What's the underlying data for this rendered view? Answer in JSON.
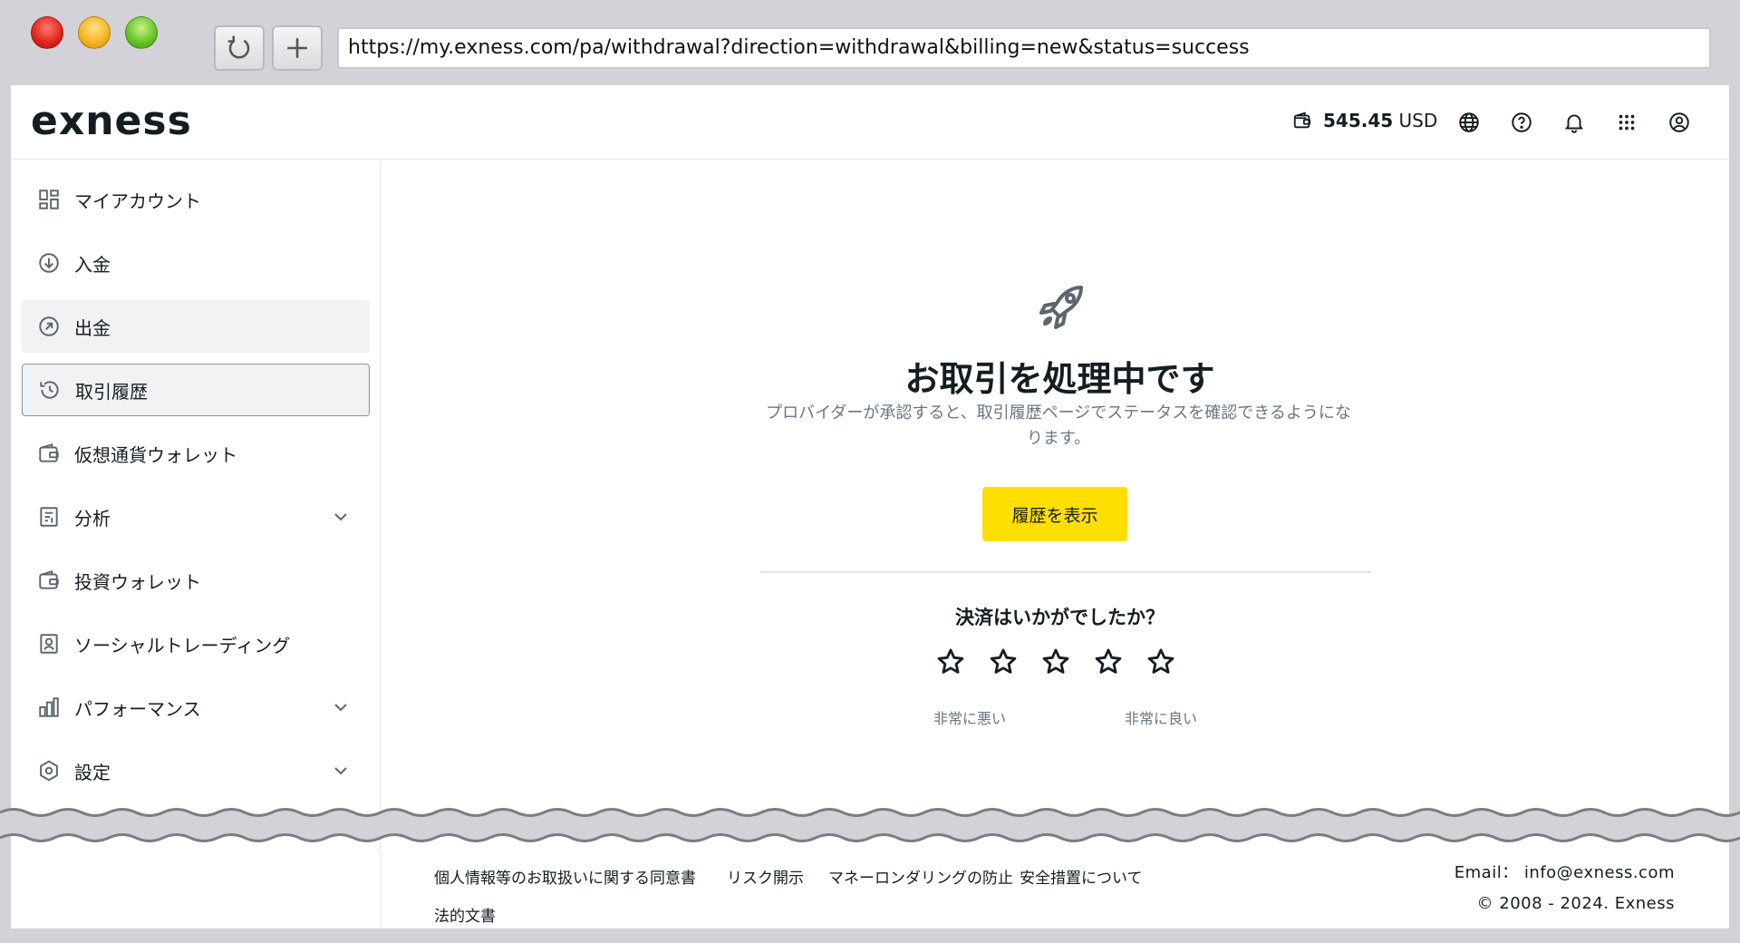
{
  "browser": {
    "url": "https://my.exness.com/pa/withdrawal?direction=withdrawal&billing=new&status=success"
  },
  "header": {
    "logo": "exness",
    "balance_amount": "545.45",
    "balance_currency": "USD"
  },
  "sidebar": {
    "items": [
      {
        "label": "マイアカウント",
        "icon": "dashboard-icon"
      },
      {
        "label": "入金",
        "icon": "deposit-icon"
      },
      {
        "label": "出金",
        "icon": "withdraw-icon"
      },
      {
        "label": "取引履歴",
        "icon": "history-icon"
      },
      {
        "label": "仮想通貨ウォレット",
        "icon": "wallet-icon"
      },
      {
        "label": "分析",
        "icon": "analytics-icon"
      },
      {
        "label": "投資ウォレット",
        "icon": "wallet-icon"
      },
      {
        "label": "ソーシャルトレーディング",
        "icon": "social-trading-icon"
      },
      {
        "label": "パフォーマンス",
        "icon": "chart-icon"
      },
      {
        "label": "設定",
        "icon": "settings-icon"
      }
    ]
  },
  "main": {
    "title": "お取引を処理中です",
    "subtitle": "プロバイダーが承認すると、取引履歴ページでステータスを確認できるようになります。",
    "history_button": "履歴を表示",
    "rating_question": "決済はいかがでしたか？",
    "rating_value": 0,
    "rating_max": 5,
    "rating_low_label": "非常に悪い",
    "rating_high_label": "非常に良い"
  },
  "footer": {
    "links": [
      "個人情報等のお取扱いに関する同意書",
      "リスク開示",
      "マネーロンダリングの防止",
      "安全措置について",
      "法的文書"
    ],
    "email": "Email：  info@exness.com",
    "copyright": "© 2008 - 2024. Exness"
  },
  "colors": {
    "accent": "#ffde02",
    "text": "#141d22",
    "muted": "#6b7680"
  }
}
